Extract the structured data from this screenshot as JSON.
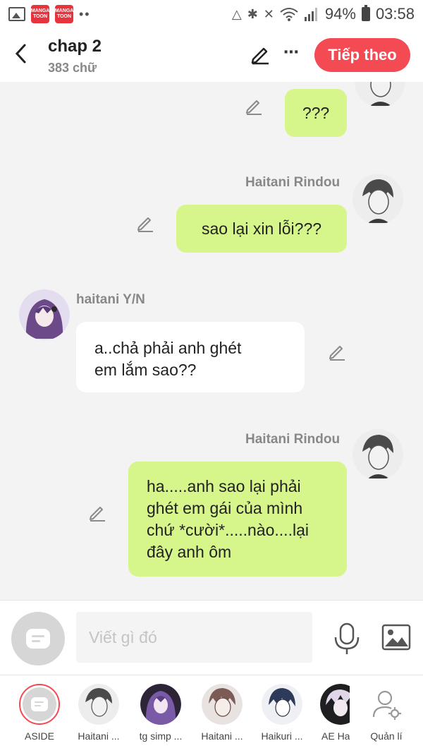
{
  "status_bar": {
    "app_badge_1": "MANGA TOON",
    "app_badge_2": "MANGA TOON",
    "battery": "94%",
    "time": "03:58"
  },
  "header": {
    "title": "chap 2",
    "word_count": "383 chữ",
    "next_label": "Tiếp theo"
  },
  "messages": [
    {
      "side": "right",
      "sender": "",
      "lines": [
        "???"
      ],
      "avatar": "haitani-rindou"
    },
    {
      "side": "right",
      "sender": "Haitani Rindou",
      "lines": [
        "sao lại xin lỗi???"
      ],
      "avatar": "haitani-rindou"
    },
    {
      "side": "left",
      "sender": "haitani Y/N",
      "lines": [
        "a..chả phải anh ghét",
        "em lắm sao??"
      ],
      "avatar": "haitani-yn"
    },
    {
      "side": "right",
      "sender": "Haitani Rindou",
      "lines": [
        "ha.....anh sao lại phải",
        "ghét em gái của mình",
        "chứ *cười*.....nào....lại",
        "đây anh ôm"
      ],
      "avatar": "haitani-rindou"
    }
  ],
  "input": {
    "placeholder": "Viết gì đó"
  },
  "characters": [
    {
      "label": "ASIDE"
    },
    {
      "label": "Haitani ..."
    },
    {
      "label": "tg simp ..."
    },
    {
      "label": "Haitani ..."
    },
    {
      "label": "Haikuri ..."
    },
    {
      "label": "AE Ha"
    },
    {
      "label": "Quản lí"
    }
  ],
  "colors": {
    "accent": "#f44a54",
    "my_bubble": "#d6f58a",
    "their_bubble": "#ffffff",
    "background": "#f3f3f3"
  }
}
